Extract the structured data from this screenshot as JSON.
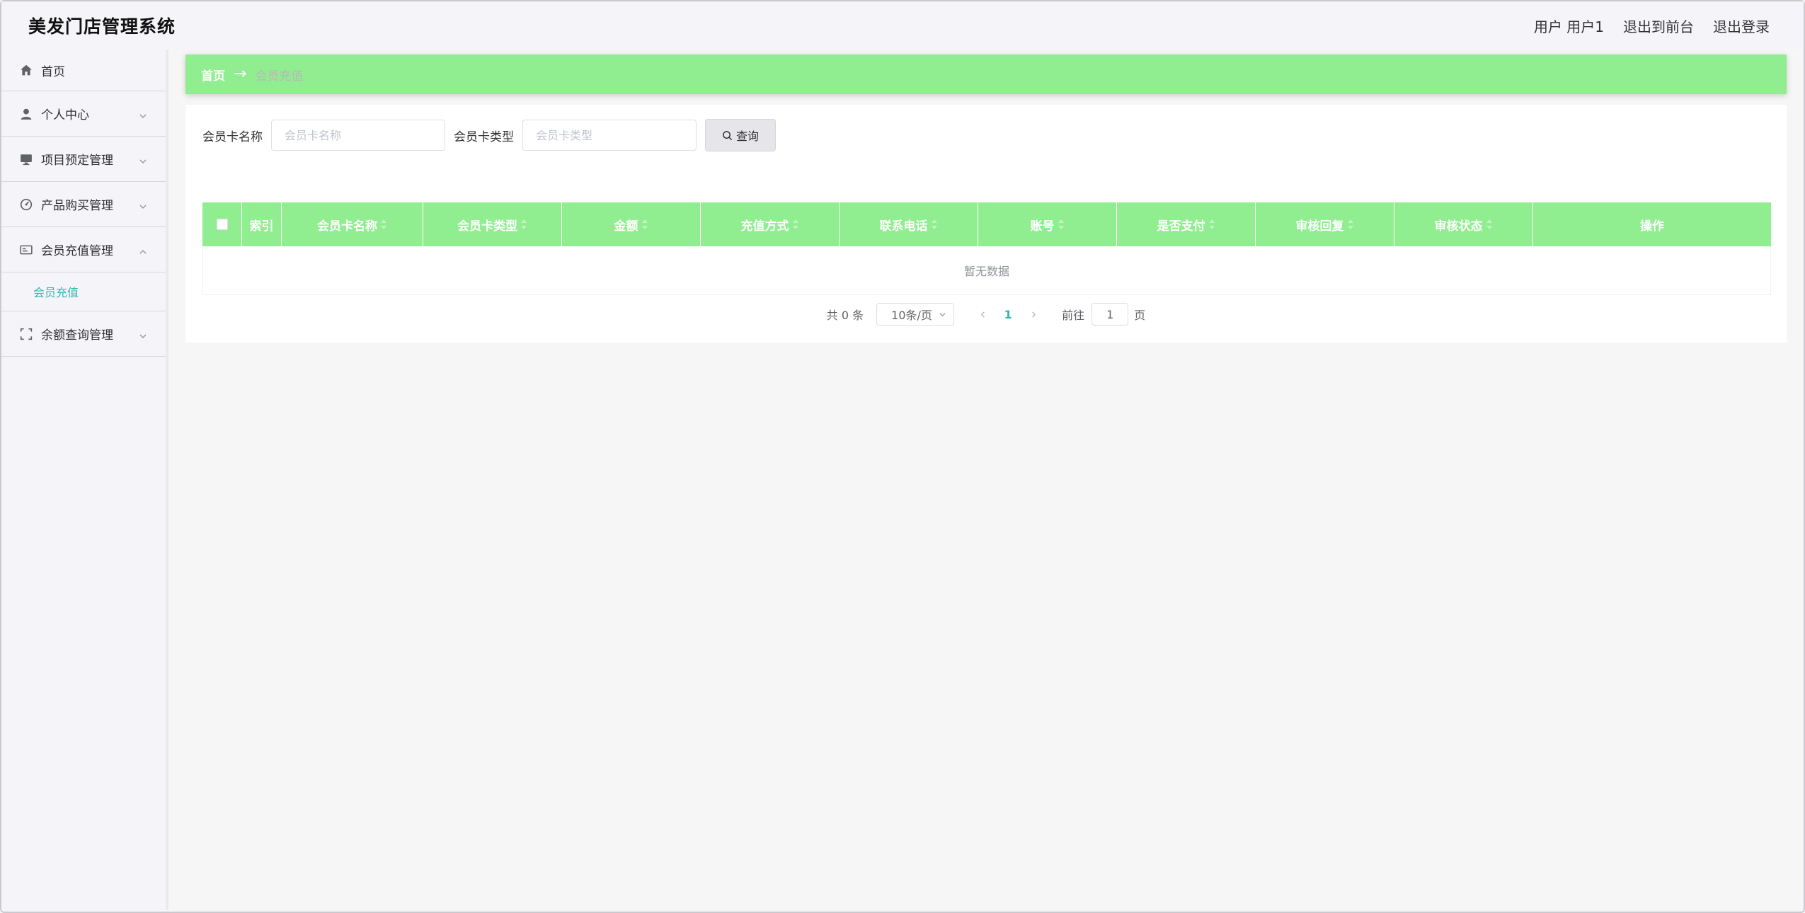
{
  "header": {
    "app_title": "美发门店管理系统",
    "user_label": "用户 用户1",
    "front_link": "退出到前台",
    "logout_link": "退出登录"
  },
  "sidebar": {
    "items": [
      {
        "label": "首页",
        "icon": "home-icon"
      },
      {
        "label": "个人中心",
        "icon": "user-icon"
      },
      {
        "label": "项目预定管理",
        "icon": "monitor-icon"
      },
      {
        "label": "产品购买管理",
        "icon": "dashboard-icon"
      },
      {
        "label": "会员充值管理",
        "icon": "card-icon",
        "expanded": true
      },
      {
        "label": "余额查询管理",
        "icon": "fullscreen-icon"
      }
    ],
    "submenu_active": "会员充值"
  },
  "breadcrumb": {
    "home": "首页",
    "arrow": "→",
    "current": "会员充值"
  },
  "search": {
    "card_name_label": "会员卡名称",
    "card_name_placeholder": "会员卡名称",
    "card_type_label": "会员卡类型",
    "card_type_placeholder": "会员卡类型",
    "query_button": "查询"
  },
  "table": {
    "columns": [
      "索引",
      "会员卡名称",
      "会员卡类型",
      "金额",
      "充值方式",
      "联系电话",
      "账号",
      "是否支付",
      "审核回复",
      "审核状态",
      "操作"
    ],
    "empty_text": "暂无数据"
  },
  "pagination": {
    "total_text": "共 0 条",
    "page_size": "10条/页",
    "current_page": "1",
    "goto_label": "前往",
    "goto_value": "1",
    "page_suffix": "页"
  },
  "colors": {
    "accent_green": "#90ee90",
    "active_teal": "#2fb8ad"
  }
}
